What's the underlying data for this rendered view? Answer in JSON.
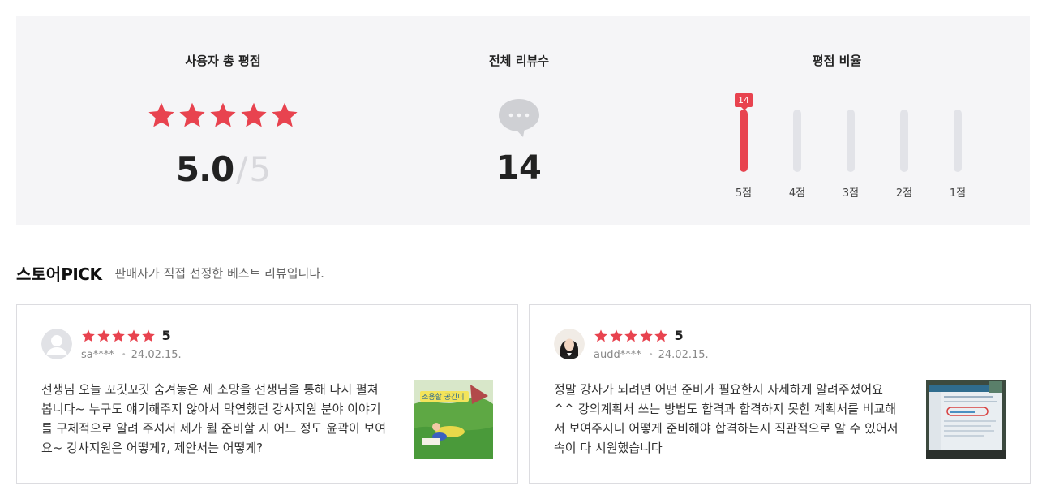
{
  "summary": {
    "rating_title": "사용자 총 평점",
    "rating_value": "5.0",
    "rating_slash": "/",
    "rating_max": "5",
    "rating_stars": 5,
    "count_title": "전체 리뷰수",
    "count_value": "14",
    "ratio_title": "평점 비율",
    "ratio": [
      {
        "label": "5점",
        "count": 14,
        "fraction": 1.0,
        "badge": "14"
      },
      {
        "label": "4점",
        "count": 0,
        "fraction": 0
      },
      {
        "label": "3점",
        "count": 0,
        "fraction": 0
      },
      {
        "label": "2점",
        "count": 0,
        "fraction": 0
      },
      {
        "label": "1점",
        "count": 0,
        "fraction": 0
      }
    ]
  },
  "pick": {
    "title_ko": "스토어",
    "title_en": "PICK",
    "description": "판매자가 직접 선정한 베스트 리뷰입니다."
  },
  "reviews": [
    {
      "score": "5",
      "user": "sa****",
      "date": "24.02.15.",
      "text": "선생님 오늘 꼬깃꼬깃 숨겨놓은 제 소망을 선생님을 통해 다시 펼쳐 봅니다~ 누구도 얘기해주지 않아서 막연했던 강사지원 분야 이야기를 구체적으로 알려 주셔서 제가 뭘 준비할 지 어느 정도 윤곽이 보여요~ 강사지원은 어떻게?, 제안서는 어떻게?",
      "thumb_caption": "조용할 공간이"
    },
    {
      "score": "5",
      "user": "audd****",
      "date": "24.02.15.",
      "text": "정말 강사가 되려면 어떤 준비가 필요한지 자세하게 알려주셨어요^^ 강의계획서 쓰는 방법도 합격과 합격하지 못한 계획서를 비교해서 보여주시니 어떻게 준비해야 합격하는지 직관적으로 알 수 있어서 속이 다 시원했습니다"
    }
  ],
  "colors": {
    "accent": "#e8434f",
    "panel_bg": "#f5f5f7",
    "bar_track": "#e2e3e8"
  },
  "icons": {
    "star": "star-icon",
    "bubble": "speech-bubble-icon",
    "avatar_default": "default-avatar-icon"
  }
}
